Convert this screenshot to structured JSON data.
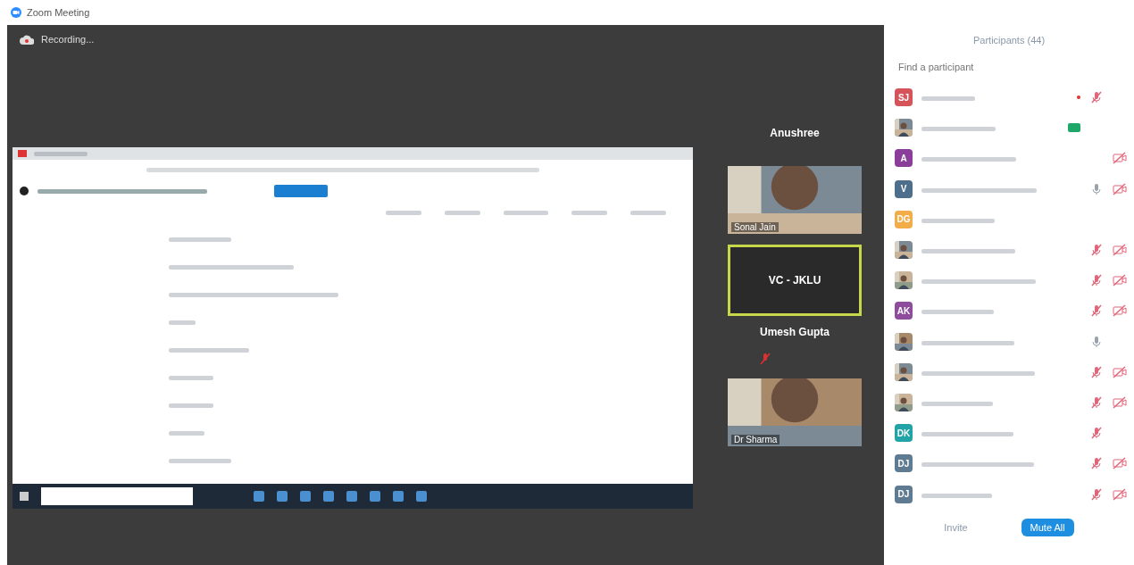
{
  "window": {
    "title": "Zoom Meeting"
  },
  "recording": {
    "label": "Recording..."
  },
  "video_strip": [
    {
      "kind": "name",
      "label": "Anushree"
    },
    {
      "kind": "video",
      "label": "Sonal Jain",
      "active": false
    },
    {
      "kind": "tile",
      "label": "VC - JKLU",
      "active": true
    },
    {
      "kind": "name",
      "label": "Umesh Gupta",
      "muted": true
    },
    {
      "kind": "video",
      "label": "Dr Sharma",
      "active": false
    }
  ],
  "participants": {
    "title": "Participants (44)",
    "search": {
      "placeholder": "Find a participant"
    },
    "rows": [
      {
        "kind": "initials",
        "initials": "SJ",
        "color": "#d4545a",
        "badge": false,
        "audio": true,
        "muted": true,
        "video_off": false,
        "dot": true
      },
      {
        "kind": "picture",
        "badge": true,
        "audio": false,
        "video_off": false,
        "dot": false
      },
      {
        "kind": "initials",
        "initials": "A",
        "color": "#8a3e9a",
        "badge": false,
        "audio": false,
        "video_off": true,
        "dot": false
      },
      {
        "kind": "initials",
        "initials": "V",
        "color": "#4d6f8c",
        "badge": false,
        "audio": true,
        "muted": false,
        "video_off": true,
        "dot": false
      },
      {
        "kind": "initials",
        "initials": "DG",
        "color": "#f2ac48",
        "badge": false,
        "audio": false,
        "video_off": false,
        "dot": false
      },
      {
        "kind": "picture",
        "badge": false,
        "audio": true,
        "muted": true,
        "video_off": true,
        "dot": false
      },
      {
        "kind": "picture",
        "badge": false,
        "audio": true,
        "muted": true,
        "video_off": true,
        "dot": false
      },
      {
        "kind": "initials",
        "initials": "AK",
        "color": "#8e4c9c",
        "badge": false,
        "audio": true,
        "muted": true,
        "video_off": true,
        "dot": false
      },
      {
        "kind": "picture",
        "badge": false,
        "audio": true,
        "muted": false,
        "video_off": false,
        "dot": false
      },
      {
        "kind": "picture",
        "badge": false,
        "audio": true,
        "muted": true,
        "video_off": true,
        "dot": false
      },
      {
        "kind": "picture",
        "badge": false,
        "audio": true,
        "muted": true,
        "video_off": true,
        "dot": false
      },
      {
        "kind": "initials",
        "initials": "DK",
        "color": "#22a3a8",
        "badge": false,
        "audio": true,
        "muted": true,
        "video_off": false,
        "dot": false
      },
      {
        "kind": "initials",
        "initials": "DJ",
        "color": "#5f7b92",
        "badge": false,
        "audio": true,
        "muted": true,
        "video_off": true,
        "dot": false
      },
      {
        "kind": "initials",
        "initials": "DJ",
        "color": "#5f7b92",
        "badge": false,
        "audio": true,
        "muted": true,
        "video_off": true,
        "dot": false
      }
    ],
    "footer": {
      "invite": "Invite",
      "mute_all": "Mute All"
    }
  }
}
